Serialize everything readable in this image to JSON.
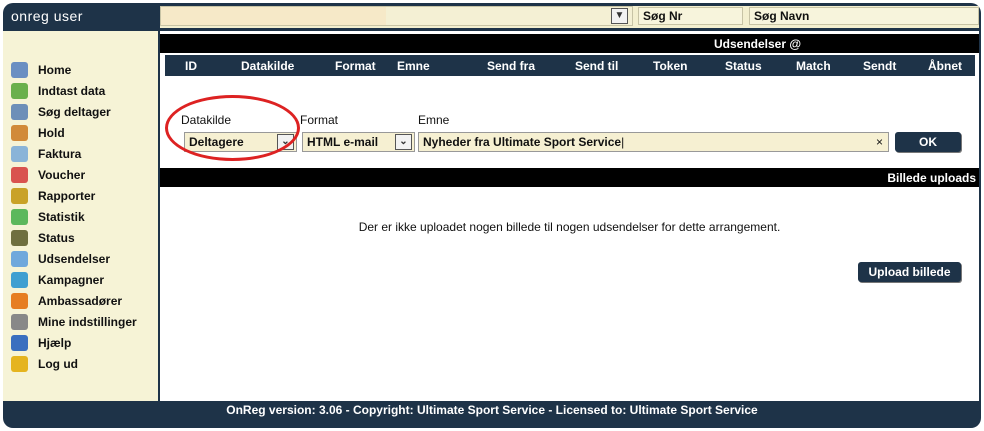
{
  "app": {
    "brand": "onreg user"
  },
  "topbar": {
    "search_nr": "Søg Nr",
    "search_name": "Søg Navn"
  },
  "sidebar": {
    "items": [
      {
        "label": "Home",
        "icon": "home-icon",
        "color": "#6a8fc2"
      },
      {
        "label": "Indtast data",
        "icon": "add-user-icon",
        "color": "#6ab04c"
      },
      {
        "label": "Søg deltager",
        "icon": "magnifier-icon",
        "color": "#6d8fb8"
      },
      {
        "label": "Hold",
        "icon": "group-icon",
        "color": "#d18a3a"
      },
      {
        "label": "Faktura",
        "icon": "document-icon",
        "color": "#8ab4d8"
      },
      {
        "label": "Voucher",
        "icon": "gift-icon",
        "color": "#d9534f"
      },
      {
        "label": "Rapporter",
        "icon": "report-icon",
        "color": "#c9a227"
      },
      {
        "label": "Statistik",
        "icon": "bar-chart-icon",
        "color": "#5cb85c"
      },
      {
        "label": "Status",
        "icon": "status-icon",
        "color": "#6f6f3f"
      },
      {
        "label": "Udsendelser",
        "icon": "mail-icon",
        "color": "#6fa8dc"
      },
      {
        "label": "Kampagner",
        "icon": "globe-icon",
        "color": "#3f9fd1"
      },
      {
        "label": "Ambassadører",
        "icon": "people-icon",
        "color": "#e67e22"
      },
      {
        "label": "Mine indstillinger",
        "icon": "gear-icon",
        "color": "#888888"
      },
      {
        "label": "Hjælp",
        "icon": "help-icon",
        "color": "#3a6fbf"
      },
      {
        "label": "Log ud",
        "icon": "lock-icon",
        "color": "#e5b41f"
      }
    ]
  },
  "main": {
    "udsendelser_header": "Udsendelser @",
    "columns": [
      "ID",
      "Datakilde",
      "Format",
      "Emne",
      "Send fra",
      "Send til",
      "Token",
      "Status",
      "Match",
      "Sendt",
      "Åbnet"
    ],
    "form": {
      "datakilde_label": "Datakilde",
      "datakilde_value": "Deltagere",
      "format_label": "Format",
      "format_value": "HTML e-mail",
      "emne_label": "Emne",
      "emne_value": "Nyheder fra Ultimate Sport Service",
      "ok_label": "OK"
    },
    "billede_header": "Billede uploads",
    "no_uploads_message": "Der er ikke uploadet nogen billede til nogen udsendelser for dette arrangement.",
    "upload_button": "Upload billede"
  },
  "footer": {
    "text": "OnReg version: 3.06 - Copyright: Ultimate Sport Service - Licensed to: Ultimate Sport Service"
  },
  "colors": {
    "navy": "#1e3348",
    "cream": "#f6f3d6",
    "annotation_red": "#dd2222"
  }
}
